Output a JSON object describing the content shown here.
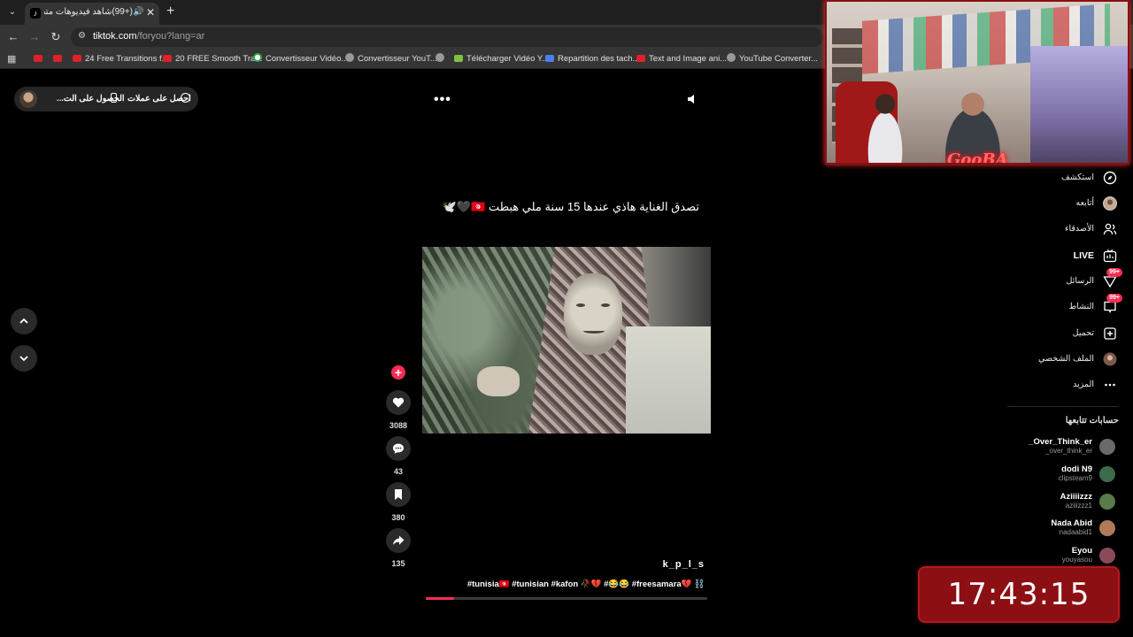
{
  "browser": {
    "tab": {
      "title": "(+99)شاهد فيديوهات متصدر",
      "favicon": "tiktok-icon",
      "sound_icon": "🔊",
      "close": "✕"
    },
    "new_tab": "+",
    "address": {
      "host": "tiktok.com",
      "path": "/foryou?lang=ar"
    },
    "bookmarks": [
      {
        "label": "",
        "icon": "youtube-icon",
        "color": "#e0202a"
      },
      {
        "label": "",
        "icon": "youtube-icon",
        "color": "#e0202a"
      },
      {
        "label": "24 Free Transitions f...",
        "icon": "youtube-icon",
        "color": "#e0202a"
      },
      {
        "label": "20 FREE Smooth Tra...",
        "icon": "youtube-icon",
        "color": "#e0202a"
      },
      {
        "label": "Convertisseur Vidéo...",
        "icon": "google-icon",
        "color": "#34a853"
      },
      {
        "label": "Convertisseur YouT...",
        "icon": "site-icon",
        "color": "#999999"
      },
      {
        "label": "",
        "icon": "globe-icon",
        "color": "#999999"
      },
      {
        "label": "Télécharger Vidéo Y...",
        "icon": "download-icon",
        "color": "#7cc242"
      },
      {
        "label": "Repartition des tach...",
        "icon": "docs-icon",
        "color": "#4a7ff0"
      },
      {
        "label": "Text and Image ani...",
        "icon": "youtube-icon",
        "color": "#e0202a"
      },
      {
        "label": "YouTube Converter...",
        "icon": "globe-icon",
        "color": "#999999"
      }
    ]
  },
  "tiktok": {
    "pill": {
      "get_app": "الحصول على الت...",
      "get_coins": "احصل على عملات"
    },
    "more_dots": "•••",
    "video": {
      "caption": "تصدق الغناية هاذي عندها 15 سنة ملي هبطت 🇹🇳🖤🕊️",
      "author": "k_p_l_s",
      "hashtags": "#tunisia🇹🇳 #tunisian #kafon 🥀💔 #😂😂 #freesamara💔 ⛓️",
      "progress": 0.1
    },
    "actions": {
      "likes": "3088",
      "comments": "43",
      "saves": "380",
      "shares": "135"
    },
    "sidebar": {
      "items": [
        {
          "label": "استكشف",
          "icon": "compass-icon"
        },
        {
          "label": "أتابعه",
          "icon": "avatar-icon"
        },
        {
          "label": "الأصدقاء",
          "icon": "friends-icon"
        },
        {
          "label": "LIVE",
          "icon": "live-icon"
        },
        {
          "label": "الرسائل",
          "icon": "messages-icon",
          "badge": "99+"
        },
        {
          "label": "النشاط",
          "icon": "activity-icon",
          "badge": "99+"
        },
        {
          "label": "تحميل",
          "icon": "upload-icon"
        },
        {
          "label": "الملف الشخصي",
          "icon": "profile-icon"
        },
        {
          "label": "المزيد",
          "icon": "more-icon"
        }
      ],
      "following_title": "حسابات تتابعها",
      "accounts": [
        {
          "name": "_Over_Think_er",
          "handle": "_over_think_er",
          "color": "#6a6a6a"
        },
        {
          "name": "dodi N9",
          "handle": "clipsteam9",
          "color": "#3c6b4a"
        },
        {
          "name": "Aziiiizzz",
          "handle": "aziiizzz1",
          "color": "#5b7a4a"
        },
        {
          "name": "Nada Abid",
          "handle": "nadaabid1",
          "color": "#b07a5a"
        },
        {
          "name": "Eyou",
          "handle": "youyasou",
          "color": "#8a4a5a"
        }
      ]
    }
  },
  "overlay": {
    "webcam_logo": "GooBA",
    "clock": "17:43:15"
  },
  "colors": {
    "accent": "#fe2c55",
    "clock_bg": "#8c0f14"
  }
}
